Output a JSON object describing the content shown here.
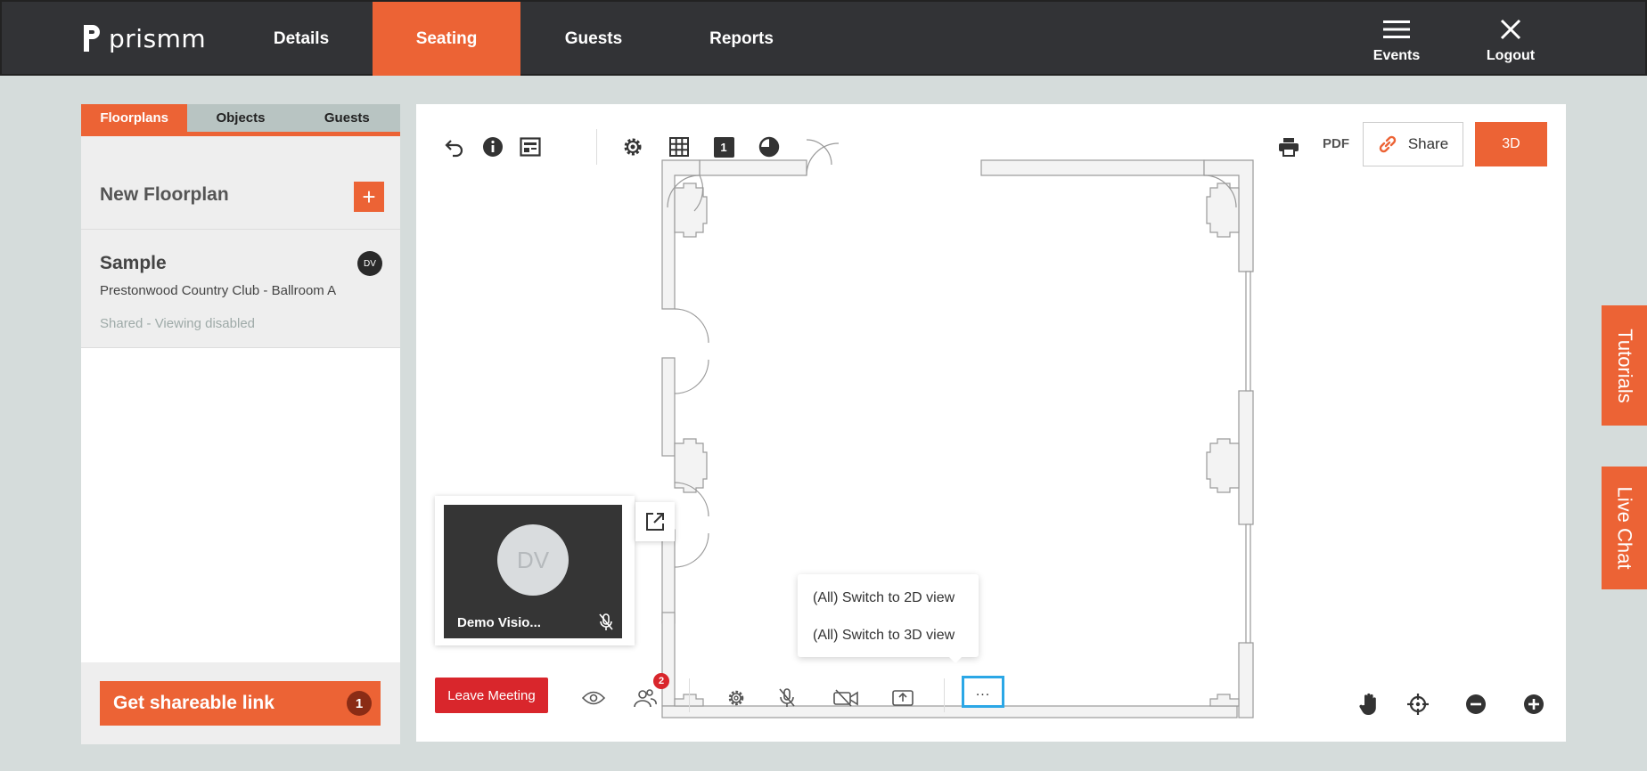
{
  "app": {
    "logo_text": "prismm"
  },
  "nav": {
    "items": [
      {
        "label": "Details"
      },
      {
        "label": "Seating"
      },
      {
        "label": "Guests"
      },
      {
        "label": "Reports"
      }
    ],
    "events_label": "Events",
    "logout_label": "Logout"
  },
  "left_panel": {
    "tabs": [
      {
        "label": "Floorplans"
      },
      {
        "label": "Objects"
      },
      {
        "label": "Guests"
      }
    ],
    "new_floorplan_label": "New Floorplan",
    "add_symbol": "+",
    "floorplans": [
      {
        "name": "Sample",
        "location": "Prestonwood Country Club - Ballroom A",
        "status": "Shared - Viewing disabled",
        "avatar": "DV"
      }
    ],
    "share_button": {
      "label": "Get shareable link",
      "count": "1"
    }
  },
  "toolbar": {
    "layer_number": "1",
    "pdf_label": "PDF",
    "share_label": "Share",
    "three_d_label": "3D"
  },
  "video": {
    "initials": "DV",
    "name": "Demo Visio..."
  },
  "meeting": {
    "leave_label": "Leave Meeting",
    "participant_count": "2",
    "more_label": "...",
    "menu_items": [
      {
        "label": "(All) Switch to 2D view"
      },
      {
        "label": "(All) Switch to 3D view"
      }
    ]
  },
  "side_tabs": {
    "tutorials_label": "Tutorials",
    "live_chat_label": "Live Chat"
  },
  "colors": {
    "accent": "#ec6335",
    "nav_bg": "#323336",
    "leave_red": "#d9262c",
    "focus_blue": "#2ba7e6"
  }
}
